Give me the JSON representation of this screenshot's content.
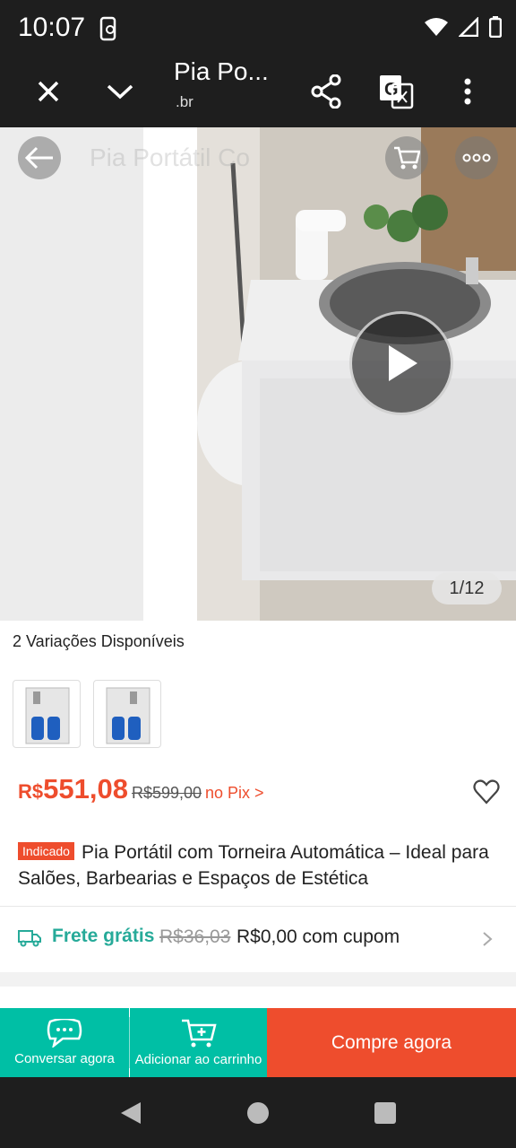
{
  "status_bar": {
    "time": "10:07"
  },
  "browser": {
    "title": "Pia Po...",
    "url": ".br"
  },
  "gallery": {
    "overlay_title": "Pia Portátil Co",
    "counter": "1/12"
  },
  "variations": {
    "label": "2 Variações Disponíveis"
  },
  "price": {
    "currency": "R$",
    "value": "551,08",
    "original": "R$599,00",
    "pix_label": "no Pix >"
  },
  "product": {
    "badge": "Indicado",
    "title": "Pia Portátil com Torneira Automática – Ideal para Salões, Barbearias e Espaços de Estética"
  },
  "shipping": {
    "label": "Frete grátis",
    "old_price": "R$36,03",
    "new_price": "R$0,00 com cupom"
  },
  "actions": {
    "chat_label": "Conversar agora",
    "cart_label": "Adicionar ao carrinho",
    "buy_label": "Compre agora"
  },
  "colors": {
    "accent": "#ee4d2d",
    "teal": "#00bfa5",
    "shipping_green": "#26aa99"
  }
}
